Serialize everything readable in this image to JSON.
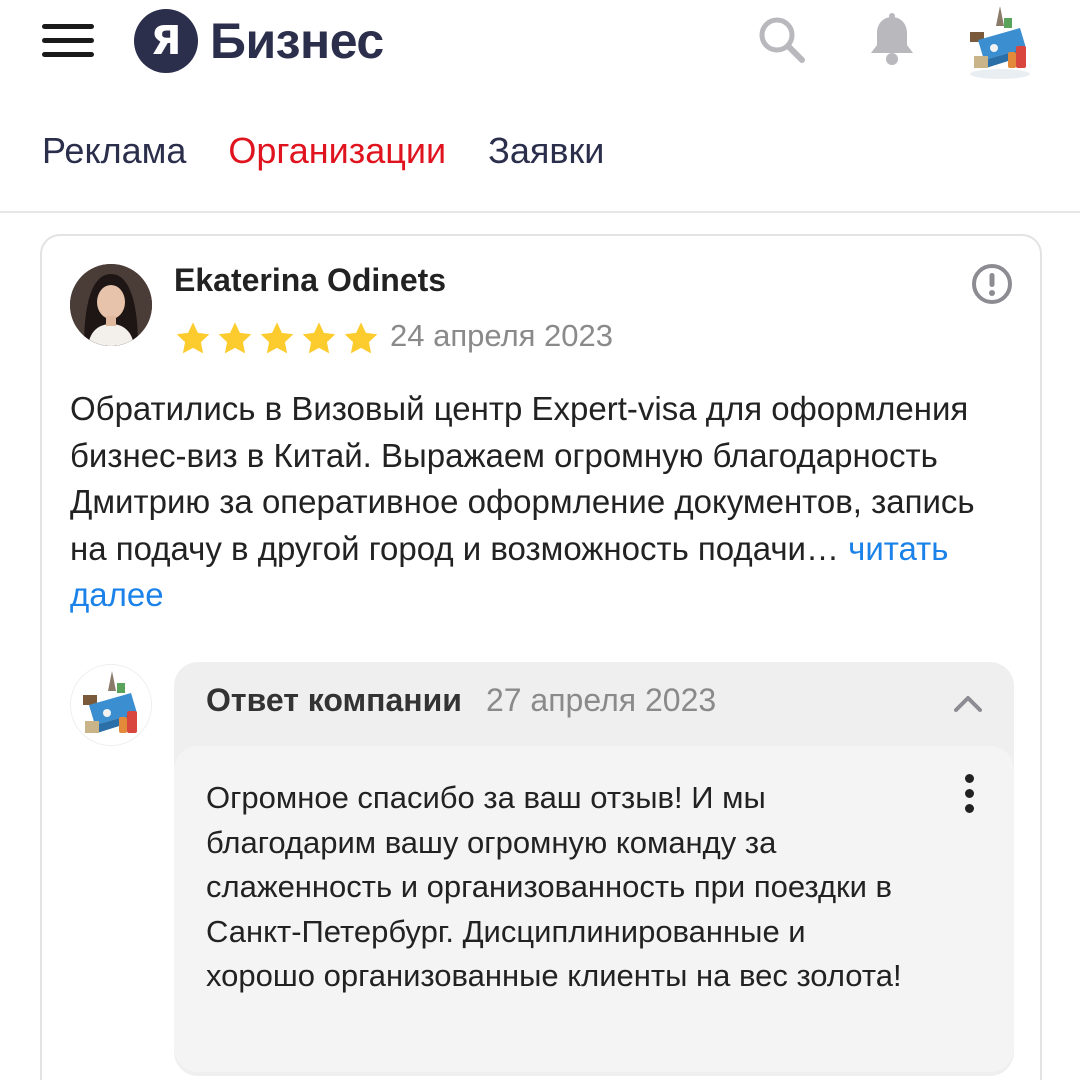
{
  "header": {
    "logo_letter": "Я",
    "logo_text": "Бизнес",
    "brand_color": "#2b2f4c",
    "icons": [
      "menu-icon",
      "search-icon",
      "bell-icon",
      "avatar"
    ]
  },
  "tabs": [
    {
      "label": "Реклама",
      "active": false
    },
    {
      "label": "Организации",
      "active": true
    },
    {
      "label": "Заявки",
      "active": false
    }
  ],
  "active_tab_color": "#e0141e",
  "review": {
    "author": "Ekaterina Odinets",
    "rating": 5,
    "max_rating": 5,
    "star_color": "#fccc2e",
    "date": "24 апреля 2023",
    "text": "Обратились в Визовый центр Expert-visa для оформления бизнес-виз в Китай. Выражаем огромную благодарность Дмитрию за оперативное оформление документов, запись на подачу в другой город и возможность подачи…",
    "read_more": "читать далее",
    "link_color": "#1a82e8"
  },
  "reply": {
    "title": "Ответ компании",
    "date": "27 апреля 2023",
    "text": "Огромное спасибо за ваш отзыв! И мы благодарим вашу огромную команду за слаженность и организованность при поездки в Санкт-Петербург. Дисциплинированные и хорошо организованные клиенты на вес золота!"
  }
}
